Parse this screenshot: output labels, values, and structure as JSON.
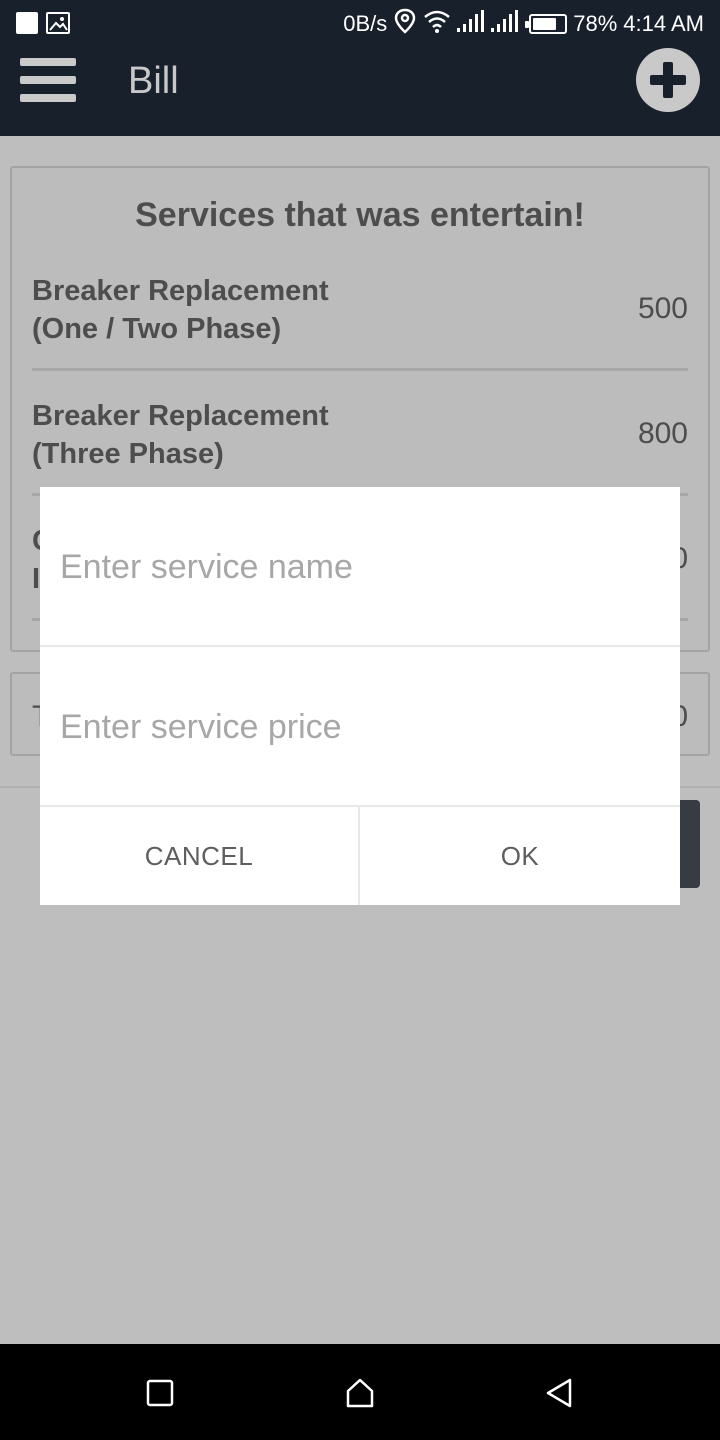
{
  "status_bar": {
    "network_speed": "0B/s",
    "battery_percent": "78%",
    "battery_level": 0.78,
    "time": "4:14 AM",
    "icons": [
      "notification-square-icon",
      "image-icon",
      "location-icon",
      "wifi-icon",
      "signal-icon",
      "signal-icon",
      "battery-icon"
    ]
  },
  "app_bar": {
    "title": "Bill",
    "menu_icon": "hamburger-menu-icon",
    "add_icon": "plus-circle-icon"
  },
  "services": {
    "title": "Services that was entertain!",
    "items": [
      {
        "name_line1": "Breaker Replacement",
        "name_line2": "(One / Two Phase)",
        "price": "500"
      },
      {
        "name_line1": "Breaker Replacement",
        "name_line2": "(Three Phase)",
        "price": "800"
      },
      {
        "name_line1": "C",
        "name_line2": "I",
        "price": "0"
      }
    ]
  },
  "total": {
    "label": "T",
    "value": "0"
  },
  "dialog": {
    "service_name_placeholder": "Enter service name",
    "service_price_placeholder": "Enter service price",
    "cancel_label": "CANCEL",
    "ok_label": "OK"
  },
  "nav_bar": {
    "icons": [
      "recent-apps-icon",
      "home-icon",
      "back-icon"
    ]
  },
  "colors": {
    "app_bar": "#18202b",
    "scrim_background": "#bebebe",
    "dialog_background": "#ffffff",
    "nav_bar": "#000000"
  }
}
